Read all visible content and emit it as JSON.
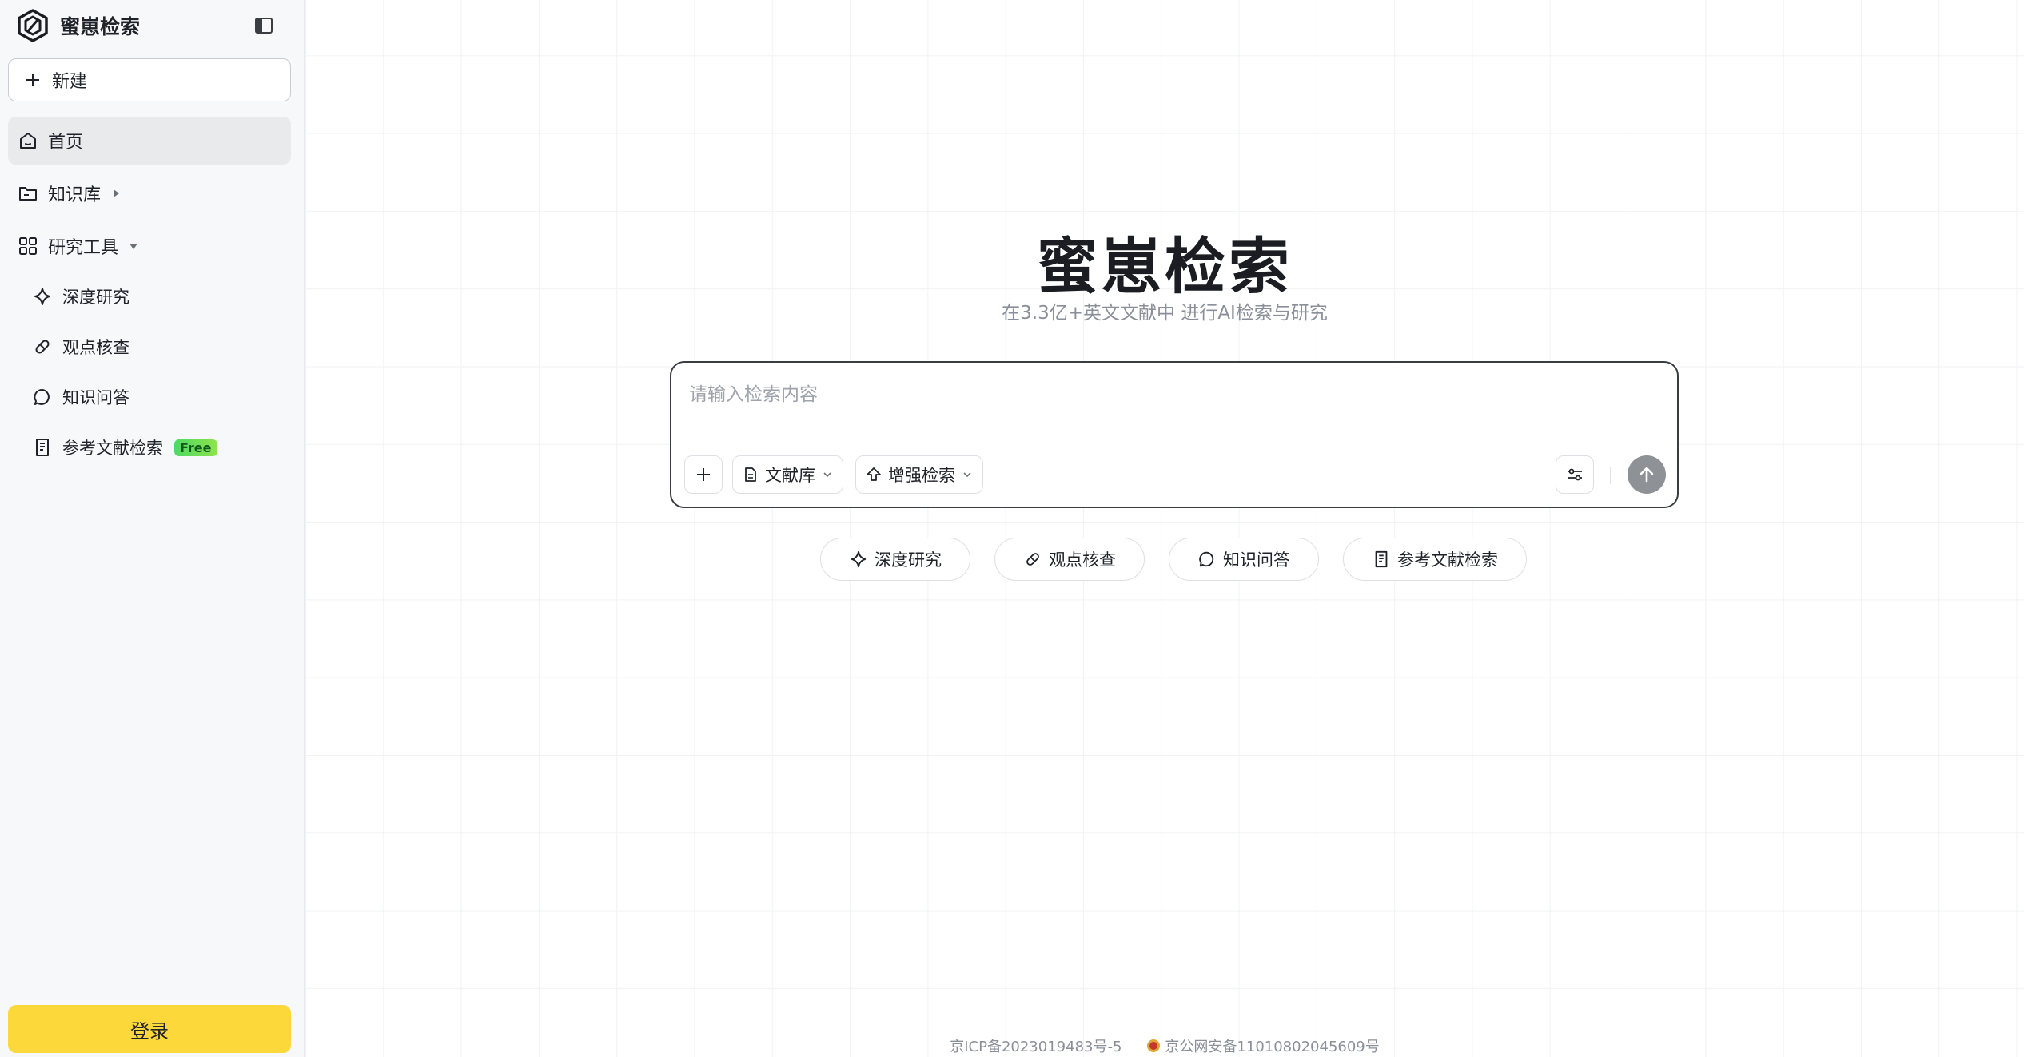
{
  "brand": {
    "name": "蜜崽检索"
  },
  "sidebar": {
    "new_label": "新建",
    "nav": [
      {
        "label": "首页",
        "icon": "home-icon"
      },
      {
        "label": "知识库",
        "icon": "folder-icon"
      },
      {
        "label": "研究工具",
        "icon": "grid-icon"
      }
    ],
    "tools": [
      {
        "label": "深度研究",
        "icon": "sparkle-icon"
      },
      {
        "label": "观点核查",
        "icon": "pill-icon"
      },
      {
        "label": "知识问答",
        "icon": "chat-bubble-icon"
      },
      {
        "label": "参考文献检索",
        "icon": "document-list-icon",
        "badge": "Free"
      }
    ],
    "login_label": "登录"
  },
  "main": {
    "title": "蜜崽检索",
    "subtitle": "在3.3亿+英文文献中 进行AI检索与研究",
    "search": {
      "placeholder": "请输入检索内容",
      "library_label": "文献库",
      "enhance_label": "增强检索"
    },
    "chips": [
      {
        "label": "深度研究",
        "icon": "sparkle-icon"
      },
      {
        "label": "观点核查",
        "icon": "pill-icon"
      },
      {
        "label": "知识问答",
        "icon": "chat-bubble-icon"
      },
      {
        "label": "参考文献检索",
        "icon": "document-list-icon"
      }
    ]
  },
  "footer": {
    "icp": "京ICP备2023019483号-5",
    "police": "京公网安备11010802045609号"
  },
  "colors": {
    "accent": "#fcd83a",
    "free_badge": "#4cd964",
    "send_button": "#8e9196"
  }
}
